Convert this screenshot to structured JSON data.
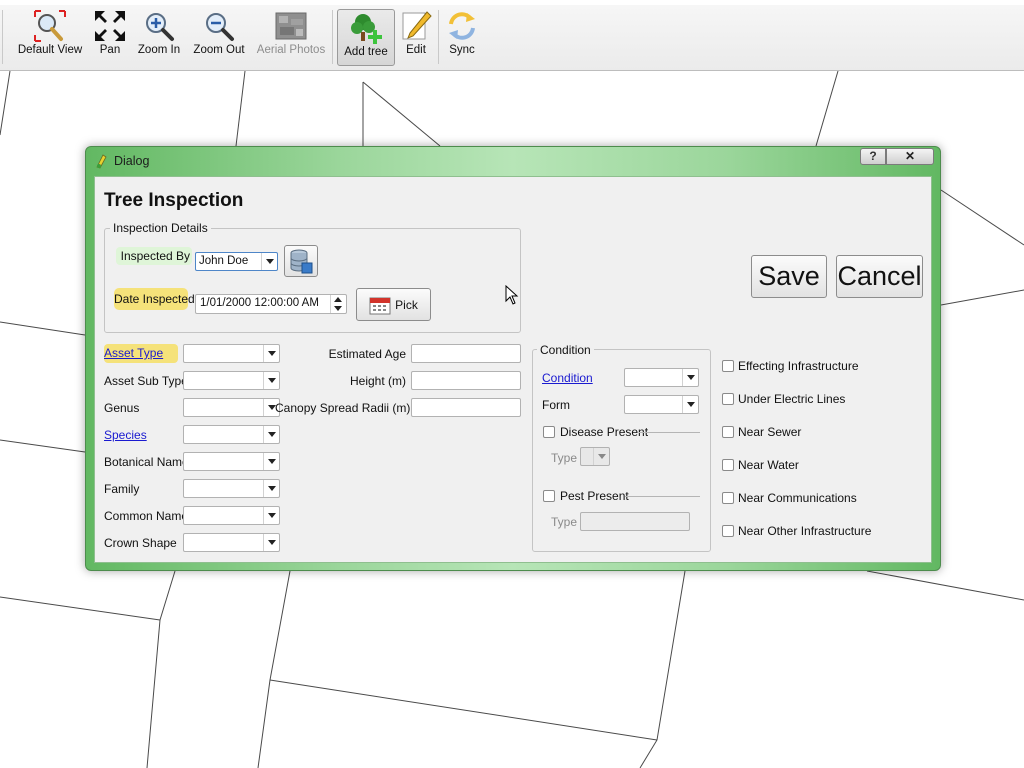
{
  "toolbar": {
    "items": [
      {
        "label": "Default View",
        "icon": "magnifier-arrows-icon"
      },
      {
        "label": "Pan",
        "icon": "pan-arrows-icon"
      },
      {
        "label": "Zoom In",
        "icon": "zoom-in-icon"
      },
      {
        "label": "Zoom Out",
        "icon": "zoom-out-icon"
      },
      {
        "label": "Aerial Photos",
        "icon": "aerial-photo-icon",
        "disabled": true
      },
      {
        "label": "Add tree",
        "icon": "add-tree-icon",
        "active": true
      },
      {
        "label": "Edit",
        "icon": "pencil-icon"
      },
      {
        "label": "Sync",
        "icon": "sync-icon"
      }
    ]
  },
  "dialog": {
    "title": "Dialog",
    "help_glyph": "?",
    "close_glyph": "✕",
    "heading": "Tree Inspection",
    "inspection_details": {
      "group_title": "Inspection Details",
      "inspected_by_label": "Inspected By",
      "inspected_by_value": "John Doe",
      "date_label": "Date Inspected",
      "date_value": "1/01/2000 12:00:00 AM",
      "pick_label": "Pick"
    },
    "save_label": "Save",
    "cancel_label": "Cancel",
    "left_fields": [
      {
        "label": "Asset Type",
        "link": true,
        "highlight": true
      },
      {
        "label": "Asset Sub Type"
      },
      {
        "label": "Genus"
      },
      {
        "label": "Species",
        "link": true
      },
      {
        "label": "Botanical Name"
      },
      {
        "label": "Family"
      },
      {
        "label": "Common Name"
      },
      {
        "label": "Crown Shape"
      }
    ],
    "mid_fields": [
      {
        "label": "Estimated Age"
      },
      {
        "label": "Height (m)"
      },
      {
        "label": "Canopy Spread Radii (m)"
      }
    ],
    "condition": {
      "group_title": "Condition",
      "condition_label": "Condition",
      "form_label": "Form",
      "disease_present_label": "Disease Present",
      "disease_type_label": "Type",
      "pest_present_label": "Pest Present",
      "pest_type_label": "Type"
    },
    "checkboxes": [
      "Effecting Infrastructure",
      "Under Electric Lines",
      "Near Sewer",
      "Near Water",
      "Near Communications",
      "Near Other Infrastructure"
    ]
  },
  "colors": {
    "dialog_frame": "#7cc87c",
    "highlight_yellow": "#f5e27a",
    "highlight_green": "#dff5d8",
    "link": "#1a1ad0"
  }
}
